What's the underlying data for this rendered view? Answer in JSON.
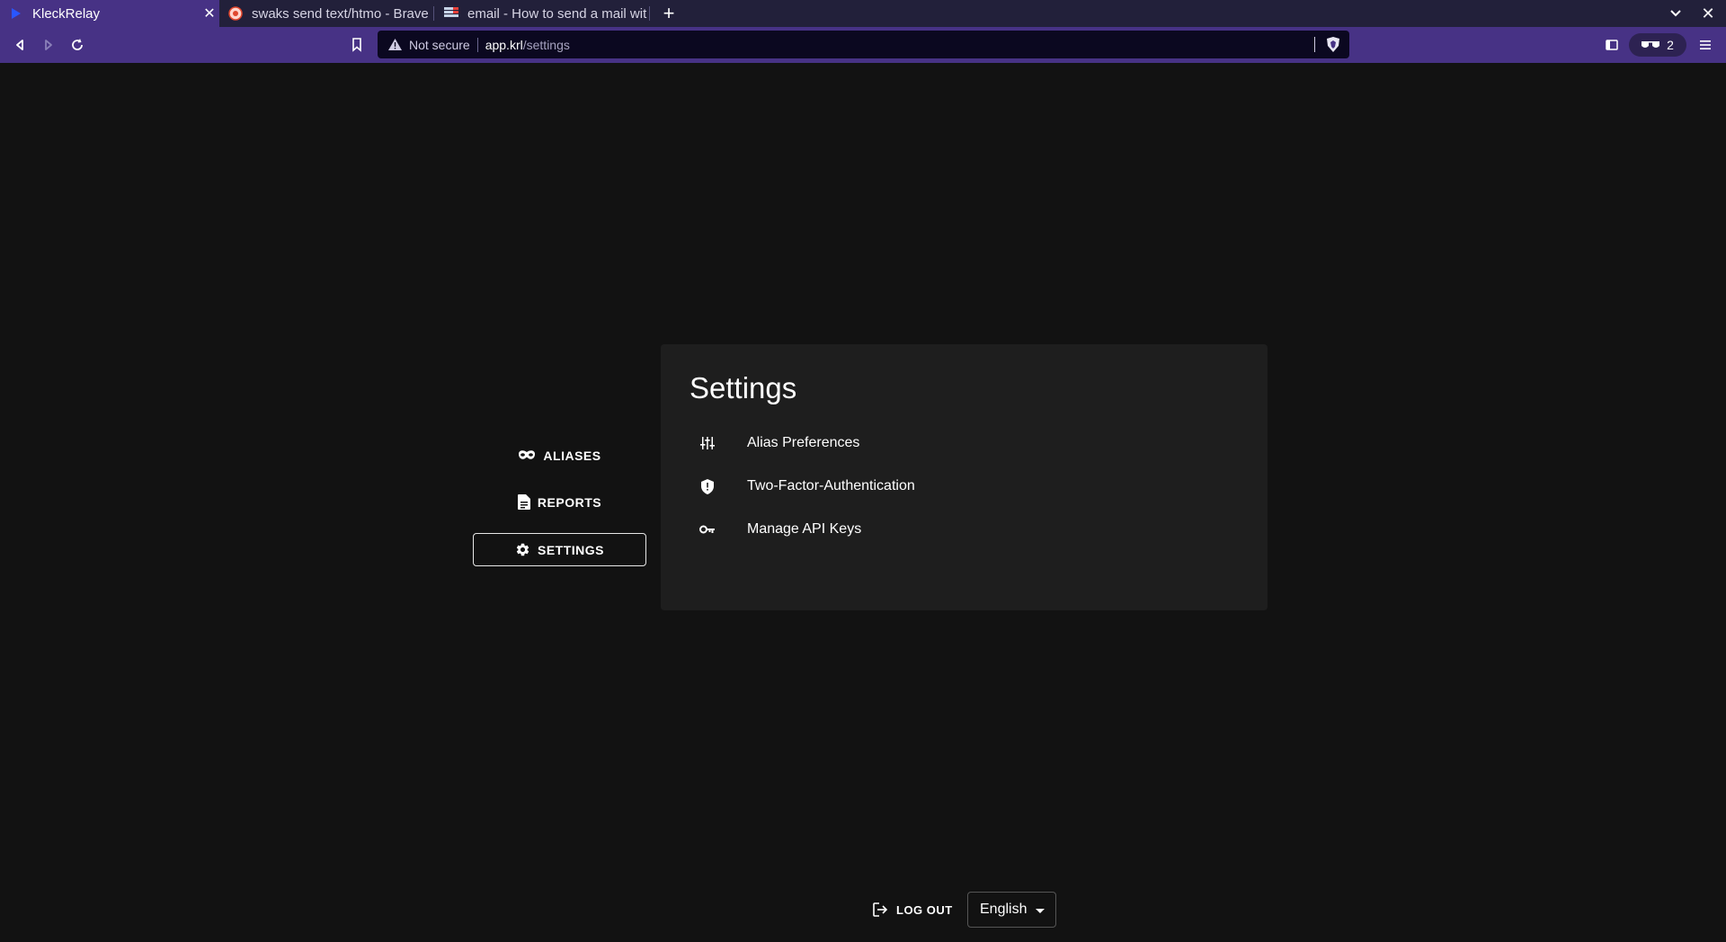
{
  "browser": {
    "tabs": [
      {
        "title": "KleckRelay",
        "active": true
      },
      {
        "title": "swaks send text/htmo - Brave",
        "active": false
      },
      {
        "title": "email - How to send a mail wit",
        "active": false
      }
    ],
    "url": {
      "security_label": "Not secure",
      "host": "app.krl",
      "path": "/settings"
    },
    "rewards_count": "2"
  },
  "nav": {
    "items": [
      {
        "label": "ALIASES",
        "icon": "mask-icon"
      },
      {
        "label": "REPORTS",
        "icon": "document-icon"
      },
      {
        "label": "SETTINGS",
        "icon": "gear-icon"
      }
    ]
  },
  "settings": {
    "title": "Settings",
    "options": [
      {
        "label": "Alias Preferences",
        "icon": "tune-icon"
      },
      {
        "label": "Two-Factor-Authentication",
        "icon": "shield-icon"
      },
      {
        "label": "Manage API Keys",
        "icon": "key-icon"
      }
    ]
  },
  "footer": {
    "logout_label": "LOG OUT",
    "language": "English"
  }
}
